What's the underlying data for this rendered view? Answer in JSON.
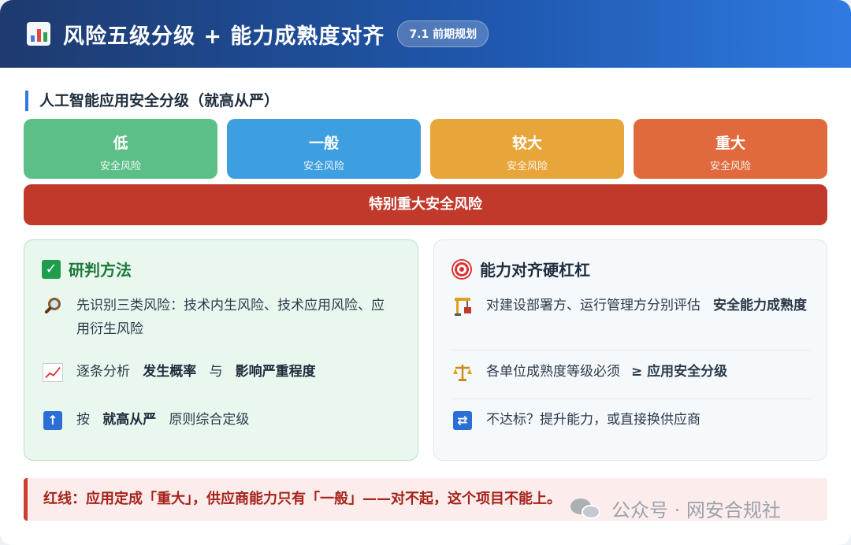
{
  "header": {
    "icon": "bar-chart-icon",
    "title": "风险五级分级 + 能力成熟度对齐",
    "badge": "7.1 前期规划"
  },
  "section": {
    "title": "人工智能应用安全分级（就高从严）"
  },
  "levels": [
    {
      "name": "低",
      "sub": "安全风险",
      "color": "#5cbf87"
    },
    {
      "name": "一般",
      "sub": "安全风险",
      "color": "#3d9ee0"
    },
    {
      "name": "较大",
      "sub": "安全风险",
      "color": "#e8a53a"
    },
    {
      "name": "重大",
      "sub": "安全风险",
      "color": "#e06a3d"
    }
  ],
  "extreme_level": {
    "label": "特别重大安全风险",
    "color": "#c0392b"
  },
  "method_panel": {
    "icon": "checkbox-icon",
    "title": "研判方法",
    "items": [
      {
        "icon": "magnifier-icon",
        "text": "先识别三类风险：技术内生风险、技术应用风险、应用衍生风险"
      },
      {
        "icon": "chart-increasing-icon",
        "text_before": "逐条分析",
        "bold1": "发生概率",
        "mid": "与",
        "bold2": "影响严重程度"
      },
      {
        "icon": "up-arrow-icon",
        "text_before": "按",
        "bold": "就高从严",
        "text_after": "原则综合定级"
      }
    ]
  },
  "align_panel": {
    "icon": "target-icon",
    "title": "能力对齐硬杠杠",
    "items": [
      {
        "icon": "crane-icon",
        "text": "对建设部署方、运行管理方分别评估",
        "bold": "安全能力成熟度"
      },
      {
        "icon": "scale-icon",
        "text": "各单位成熟度等级必须",
        "bold": "≥ 应用安全分级"
      },
      {
        "icon": "cycle-arrows-icon",
        "text": "不达标？提升能力，或直接换供应商"
      }
    ]
  },
  "redline": {
    "text": "红线：应用定成「重大」，供应商能力只有「一般」——对不起，这个项目不能上。"
  },
  "watermark": {
    "text": "公众号 · 网安合规社"
  }
}
